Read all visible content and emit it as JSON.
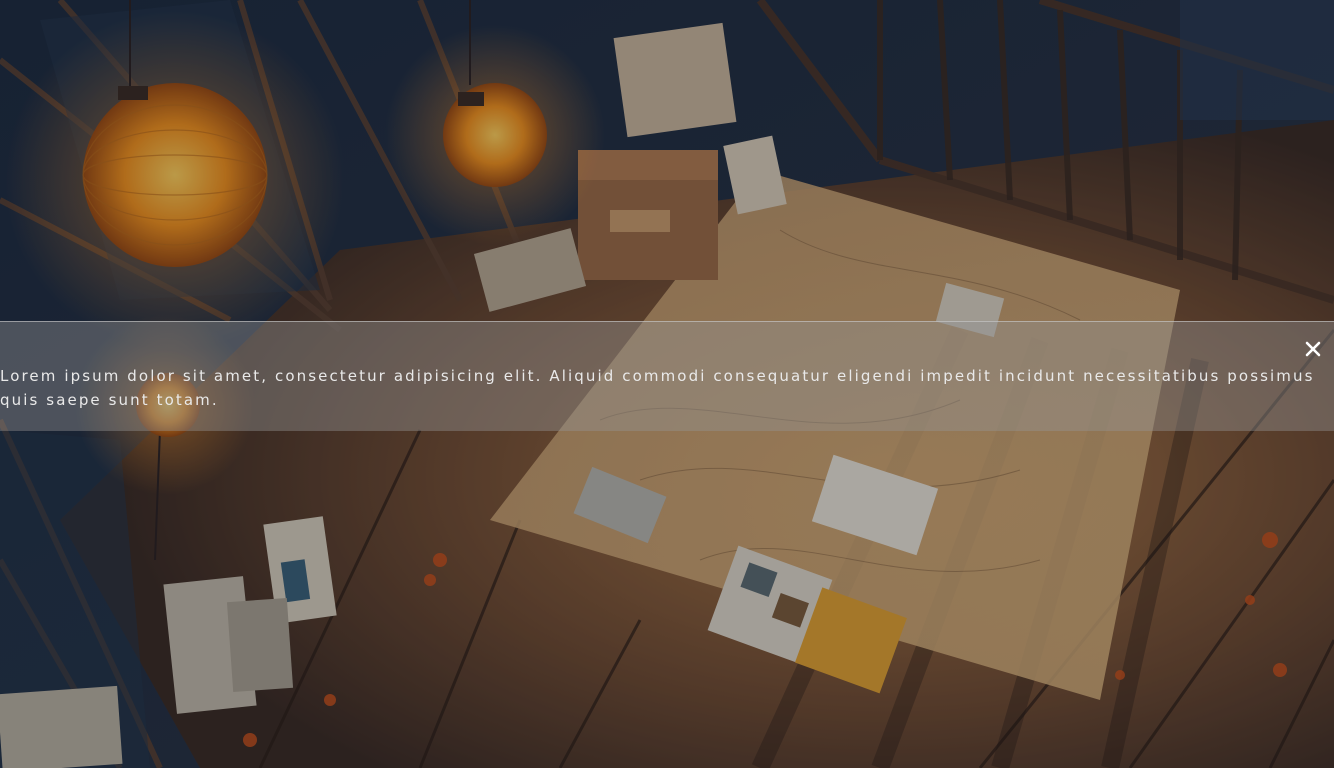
{
  "banner": {
    "line1": "Lorem ipsum dolor sit amet, consectetur adipisicing elit. Aliquid commodi consequatur eligendi impedit incidunt necessitatibus possimus",
    "line2": "quis saepe sunt totam.",
    "close_icon": "close-icon"
  },
  "background": {
    "description_icon": "illustration",
    "palette": {
      "night": "#1d2738",
      "wood": "#6b4a32",
      "lantern": "#f0a030",
      "paper": "#c9a67a"
    }
  }
}
